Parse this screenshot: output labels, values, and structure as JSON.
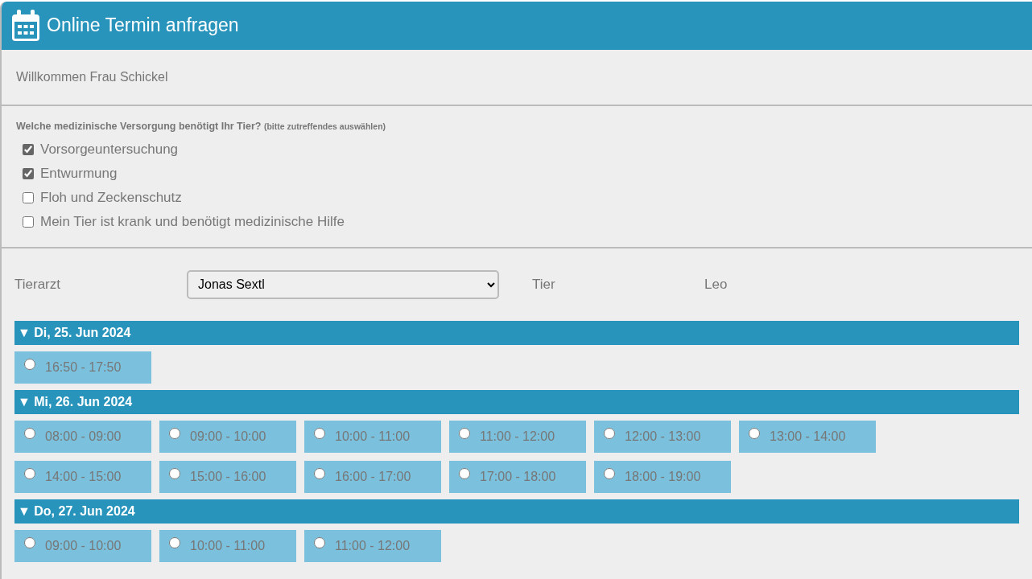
{
  "header": {
    "title": "Online Termin anfragen"
  },
  "welcome": "Willkommen Frau Schickel",
  "question": {
    "text": "Welche medizinische Versorgung benötigt Ihr Tier?",
    "hint": "(bitte zutreffendes auswählen)"
  },
  "options": [
    {
      "label": "Vorsorgeuntersuchung",
      "checked": true
    },
    {
      "label": "Entwurmung",
      "checked": true
    },
    {
      "label": "Floh und Zeckenschutz",
      "checked": false
    },
    {
      "label": "Mein Tier ist krank und benötigt medizinische Hilfe",
      "checked": false
    }
  ],
  "vet": {
    "label": "Tierarzt",
    "value": "Jonas Sextl"
  },
  "pet": {
    "label": "Tier",
    "value": "Leo"
  },
  "days": [
    {
      "marker": "▼",
      "date": "Di, 25. Jun 2024",
      "slots": [
        {
          "time": "16:50 - 17:50",
          "selected": false
        }
      ]
    },
    {
      "marker": "▼",
      "date": "Mi, 26. Jun 2024",
      "slots": [
        {
          "time": "08:00 - 09:00",
          "selected": false
        },
        {
          "time": "09:00 - 10:00",
          "selected": false
        },
        {
          "time": "10:00 - 11:00",
          "selected": false
        },
        {
          "time": "11:00 - 12:00",
          "selected": false
        },
        {
          "time": "12:00 - 13:00",
          "selected": false
        },
        {
          "time": "13:00 - 14:00",
          "selected": false
        },
        {
          "time": "14:00 - 15:00",
          "selected": false
        },
        {
          "time": "15:00 - 16:00",
          "selected": false
        },
        {
          "time": "16:00 - 17:00",
          "selected": false
        },
        {
          "time": "17:00 - 18:00",
          "selected": false
        },
        {
          "time": "18:00 - 19:00",
          "selected": false
        }
      ]
    },
    {
      "marker": "▼",
      "date": "Do, 27. Jun 2024",
      "slots": [
        {
          "time": "09:00 - 10:00",
          "selected": false
        },
        {
          "time": "10:00 - 11:00",
          "selected": false
        },
        {
          "time": "11:00 - 12:00",
          "selected": false
        }
      ]
    }
  ]
}
